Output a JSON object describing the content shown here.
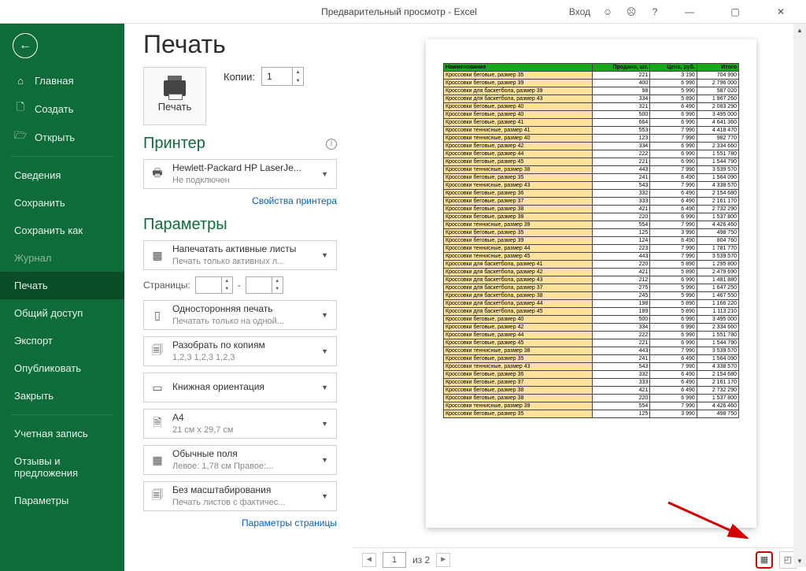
{
  "titlebar": {
    "title": "Предварительный просмотр  -  Excel",
    "login": "Вход"
  },
  "sidebar": {
    "items": [
      {
        "label": "Главная",
        "ico": "⌂"
      },
      {
        "label": "Создать",
        "ico": "🗋"
      },
      {
        "label": "Открыть",
        "ico": "🗁"
      },
      {
        "label": "Сведения"
      },
      {
        "label": "Сохранить"
      },
      {
        "label": "Сохранить как"
      },
      {
        "label": "Журнал",
        "dim": true
      },
      {
        "label": "Печать",
        "sel": true
      },
      {
        "label": "Общий доступ"
      },
      {
        "label": "Экспорт"
      },
      {
        "label": "Опубликовать"
      },
      {
        "label": "Закрыть"
      },
      {
        "label": "Учетная запись"
      },
      {
        "label": "Отзывы и предложения"
      },
      {
        "label": "Параметры"
      }
    ]
  },
  "print": {
    "title": "Печать",
    "button": "Печать",
    "copies_label": "Копии:",
    "copies": "1",
    "printer_h": "Принтер",
    "printer_name": "Hewlett-Packard HP LaserJe...",
    "printer_status": "Не подключен",
    "printer_props": "Свойства принтера",
    "params_h": "Параметры",
    "opt_active": "Напечатать активные листы",
    "opt_active_sub": "Печать только активных л...",
    "pages_label": "Страницы:",
    "pages_sep": "-",
    "opt_oneside": "Односторонняя печать",
    "opt_oneside_sub": "Печатать только на одной...",
    "opt_collate": "Разобрать по копиям",
    "opt_collate_sub": "1,2,3    1,2,3    1,2,3",
    "opt_orient": "Книжная ориентация",
    "opt_size": "A4",
    "opt_size_sub": "21 см x 29,7 см",
    "opt_margins": "Обычные поля",
    "opt_margins_sub": "Левое: 1,78 см    Правое:...",
    "opt_scale": "Без масштабирования",
    "opt_scale_sub": "Печать листов с фактичес...",
    "page_setup": "Параметры страницы"
  },
  "preview": {
    "headers": [
      "Наименование",
      "Продано, шт.",
      "Цена, руб.",
      "Итого"
    ],
    "rows": [
      [
        "Кроссовки беговые, размер 35",
        221,
        "3 190",
        "704 990"
      ],
      [
        "Кроссовки беговые, размер 39",
        400,
        "6 990",
        "2 796 000"
      ],
      [
        "Кроссовки для баскетбола, размер 39",
        98,
        "5 990",
        "587 020"
      ],
      [
        "Кроссовки для баскетбола, размер 43",
        334,
        "5 890",
        "1 967 260"
      ],
      [
        "Кроссовки беговые, размер 40",
        321,
        "6 490",
        "2 083 290"
      ],
      [
        "Кроссовки беговые, размер 40",
        500,
        "6 990",
        "3 495 000"
      ],
      [
        "Кроссовки беговые, размер 41",
        664,
        "6 990",
        "4 641 360"
      ],
      [
        "Кроссовки теннисные, размер 41",
        553,
        "7 990",
        "4 418 470"
      ],
      [
        "Кроссовки теннисные, размер 40",
        123,
        "7 990",
        "982 770"
      ],
      [
        "Кроссовки беговые, размер 42",
        334,
        "6 990",
        "2 334 660"
      ],
      [
        "Кроссовки беговые, размер 44",
        222,
        "6 990",
        "1 551 780"
      ],
      [
        "Кроссовки беговые, размер 45",
        221,
        "6 990",
        "1 544 790"
      ],
      [
        "Кроссовки теннисные, размер 38",
        443,
        "7 990",
        "3 539 570"
      ],
      [
        "Кроссовки беговые, размер 35",
        241,
        "6 490",
        "1 564 090"
      ],
      [
        "Кроссовки теннисные, размер 43",
        543,
        "7 990",
        "4 338 570"
      ],
      [
        "Кроссовки беговые, размер 36",
        332,
        "6 490",
        "2 154 680"
      ],
      [
        "Кроссовки беговые, размер 37",
        333,
        "6 490",
        "2 161 170"
      ],
      [
        "Кроссовки беговые, размер 38",
        421,
        "6 490",
        "2 732 290"
      ],
      [
        "Кроссовки беговые, размер 38",
        220,
        "6 990",
        "1 537 800"
      ],
      [
        "Кроссовки теннисные, размер 39",
        554,
        "7 990",
        "4 426 460"
      ],
      [
        "Кроссовки беговые, размер 35",
        125,
        "3 990",
        "498 750"
      ],
      [
        "Кроссовки беговые, размер 39",
        124,
        "6 490",
        "804 760"
      ],
      [
        "Кроссовки теннисные, размер 44",
        223,
        "7 990",
        "1 781 770"
      ],
      [
        "Кроссовки теннисные, размер 45",
        443,
        "7 990",
        "3 539 570"
      ],
      [
        "Кроссовки для баскетбола, размер 41",
        220,
        "5 890",
        "1 295 800"
      ],
      [
        "Кроссовки для баскетбола, размер 42",
        421,
        "5 890",
        "2 479 690"
      ],
      [
        "Кроссовки для баскетбола, размер 43",
        212,
        "6 990",
        "1 481 880"
      ],
      [
        "Кроссовки для баскетбола, размер 37",
        275,
        "5 990",
        "1 647 250"
      ],
      [
        "Кроссовки для баскетбола, размер 38",
        245,
        "5 990",
        "1 467 550"
      ],
      [
        "Кроссовки для баскетбола, размер 44",
        198,
        "5 890",
        "1 166 220"
      ],
      [
        "Кроссовки для баскетбола, размер 45",
        189,
        "5 890",
        "1 113 210"
      ],
      [
        "Кроссовки беговые, размер 40",
        500,
        "6 990",
        "3 495 000"
      ],
      [
        "Кроссовки беговые, размер 42",
        334,
        "6 990",
        "2 334 660"
      ],
      [
        "Кроссовки беговые, размер 44",
        222,
        "6 990",
        "1 551 780"
      ],
      [
        "Кроссовки беговые, размер 45",
        221,
        "6 990",
        "1 544 790"
      ],
      [
        "Кроссовки теннисные, размер 38",
        443,
        "7 990",
        "3 539 570"
      ],
      [
        "Кроссовки беговые, размер 35",
        241,
        "6 490",
        "1 564 090"
      ],
      [
        "Кроссовки теннисные, размер 43",
        543,
        "7 990",
        "4 338 570"
      ],
      [
        "Кроссовки беговые, размер 36",
        332,
        "6 490",
        "2 154 680"
      ],
      [
        "Кроссовки беговые, размер 37",
        333,
        "6 490",
        "2 161 170"
      ],
      [
        "Кроссовки беговые, размер 38",
        421,
        "6 490",
        "2 732 290"
      ],
      [
        "Кроссовки беговые, размер 38",
        220,
        "6 990",
        "1 537 800"
      ],
      [
        "Кроссовки теннисные, размер 39",
        554,
        "7 990",
        "4 426 460"
      ],
      [
        "Кроссовки беговые, размер 35",
        125,
        "3 990",
        "498 750"
      ]
    ],
    "page_current": "1",
    "page_of": "из 2"
  }
}
